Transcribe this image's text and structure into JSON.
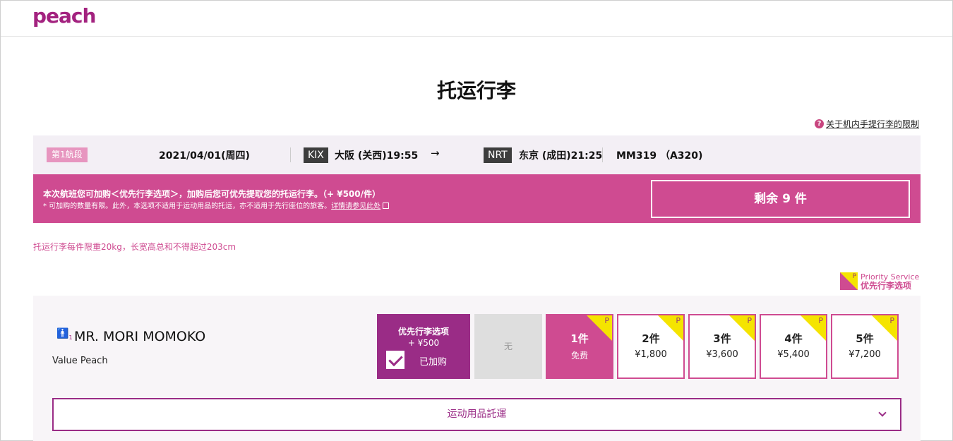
{
  "header": {
    "logo": "peach"
  },
  "page": {
    "title": "托运行李",
    "help_link": "关于机内手提行李的限制"
  },
  "flight": {
    "segment": "第1航段",
    "date": "2021/04/01(周四)",
    "origin_code": "KIX",
    "origin": "大阪 (关西)19:55",
    "arrow": "→",
    "dest_code": "NRT",
    "dest": "东京 (成田)21:25",
    "flight_no": "MM319 （A320)"
  },
  "promo": {
    "line1": "本次航班您可加购＜优先行李选项＞，加购后您可优先提取您的托运行李。（+ ¥500/件）",
    "line2": "* 可加购的数量有限。此外，本选项不适用于运动用品的托运，亦不适用于先行座位的旅客。",
    "link": "详情请参见此处",
    "remaining": "剩余 9 件"
  },
  "weight_note": "托运行李每件限重20kg，长宽高总和不得超过203cm",
  "priority_legend": {
    "en": "Priority Service",
    "cn": "优先行李选项",
    "icon": "priority-p-icon",
    "p": "P"
  },
  "passenger": {
    "name": "MR. MORI MOMOKO",
    "fare": "Value Peach",
    "icon": "person-icon",
    "index": "1"
  },
  "priority_option": {
    "title": "优先行李选项",
    "price": "+ ¥500",
    "status": "已加购",
    "checked": true
  },
  "none_option": "无",
  "bag_options": [
    {
      "count": "1件",
      "price": "免费",
      "selected": true
    },
    {
      "count": "2件",
      "price": "¥1,800",
      "selected": false
    },
    {
      "count": "3件",
      "price": "¥3,600",
      "selected": false
    },
    {
      "count": "4件",
      "price": "¥5,400",
      "selected": false
    },
    {
      "count": "5件",
      "price": "¥7,200",
      "selected": false
    }
  ],
  "sports": {
    "label": "运动用品託運"
  },
  "colors": {
    "brand": "#a3227f",
    "pink": "#cf4b91",
    "purple": "#9a2c86",
    "yellow": "#f5e400"
  }
}
